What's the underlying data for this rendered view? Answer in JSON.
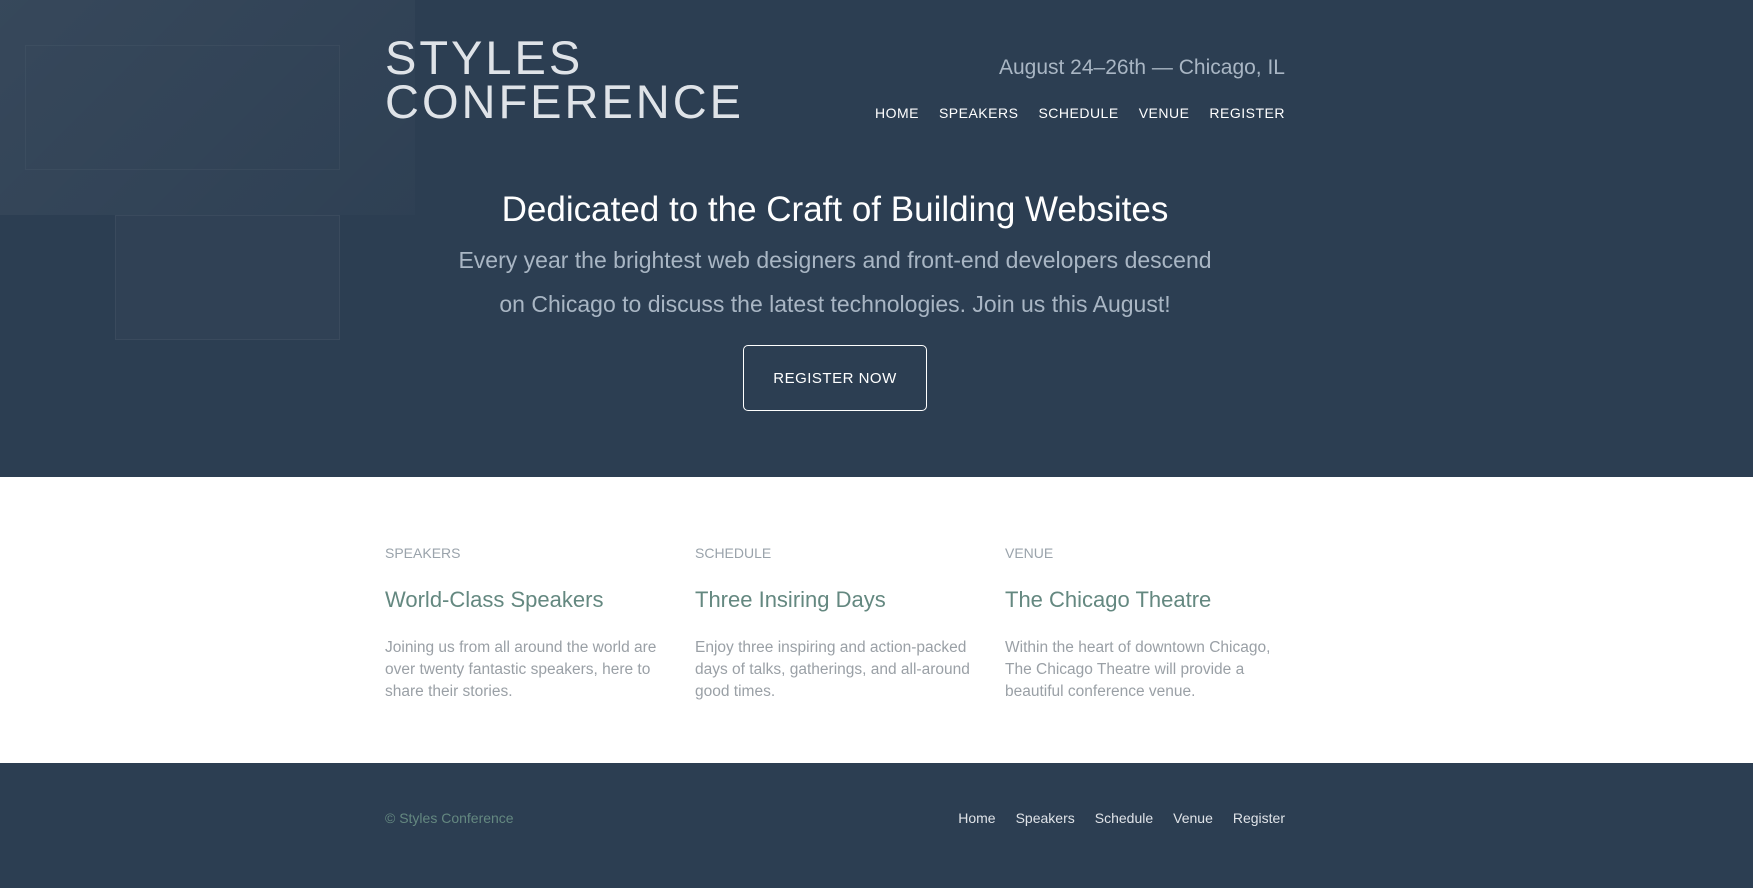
{
  "header": {
    "logo_line1": "Styles",
    "logo_line2": "Conference",
    "tagline": "August 24–26th — Chicago, IL",
    "nav": [
      "Home",
      "Speakers",
      "Schedule",
      "Venue",
      "Register"
    ]
  },
  "hero": {
    "title": "Dedicated to the Craft of Building Websites",
    "text": "Every year the brightest web designers and front-end developers descend on Chicago to discuss the latest technologies. Join us this August!",
    "button": "Register Now"
  },
  "teasers": [
    {
      "label": "Speakers",
      "title": "World-Class Speakers",
      "text": "Joining us from all around the world are over twenty fantastic speakers, here to share their stories."
    },
    {
      "label": "Schedule",
      "title": "Three Insiring Days",
      "text": "Enjoy three inspiring and action-packed days of talks, gatherings, and all-around good times."
    },
    {
      "label": "Venue",
      "title": "The Chicago Theatre",
      "text": "Within the heart of downtown Chicago, The Chicago Theatre will provide a beautiful conference venue."
    }
  ],
  "footer": {
    "copyright": "© Styles Conference",
    "nav": [
      "Home",
      "Speakers",
      "Schedule",
      "Venue",
      "Register"
    ]
  },
  "colors": {
    "hero_bg": "#2c3e52",
    "accent_green": "#648880",
    "muted_text": "#a9b6c4"
  }
}
